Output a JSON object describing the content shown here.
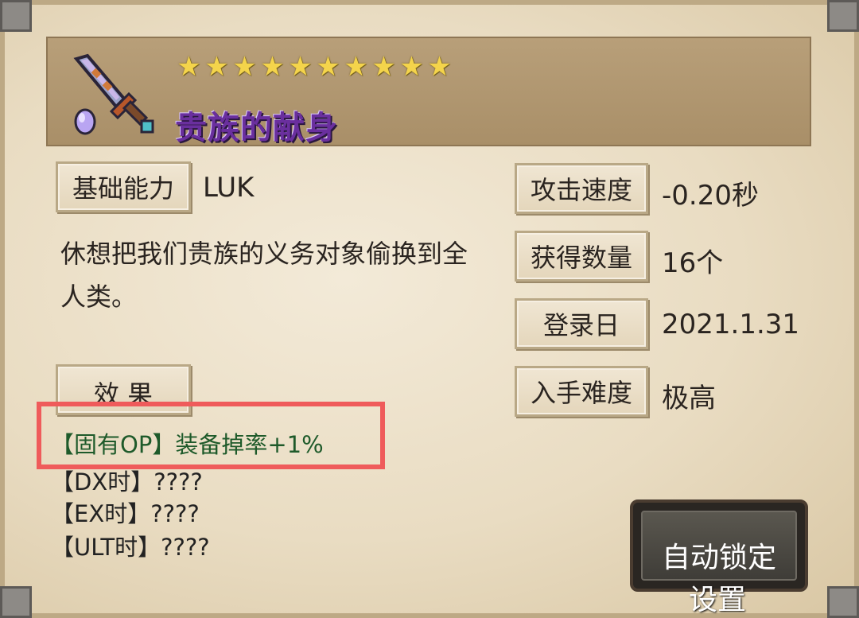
{
  "item": {
    "name": "贵族的献身",
    "star_count": 10,
    "star_glyph": "★",
    "icon": "sword-icon",
    "gem_icon": "gem-icon"
  },
  "stats": {
    "base_label": "基础能力",
    "base_value": "LUK",
    "atk_speed_label": "攻击速度",
    "atk_speed_value": "-0.20秒",
    "obtained_label": "获得数量",
    "obtained_value": "16个",
    "register_label": "登录日",
    "register_value": "2021.1.31",
    "difficulty_label": "入手难度",
    "difficulty_value": "极高"
  },
  "description": "休想把我们贵族的义务对象偷换到全人类。",
  "effect": {
    "label": "效 果",
    "lines": [
      "【固有OP】装备掉率+1%",
      "【DX时】????",
      "【EX时】????",
      "【ULT时】????"
    ]
  },
  "buttons": {
    "auto_lock": "自动锁定",
    "settings": "设置"
  },
  "colors": {
    "highlight": "#ef5b5b",
    "name": "#6a2f9e",
    "star": "#f4d44b"
  }
}
